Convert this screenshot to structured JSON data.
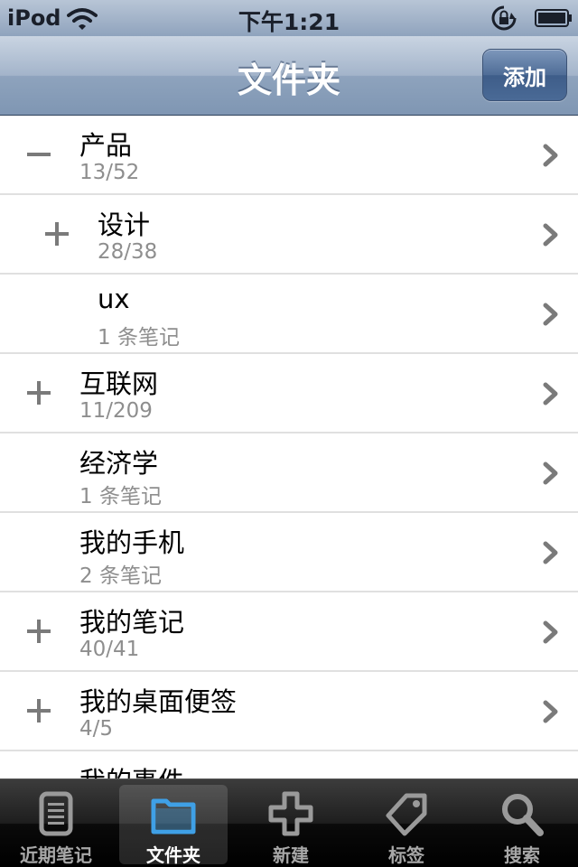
{
  "status_bar": {
    "carrier": "iPod",
    "time": "下午1:21"
  },
  "nav": {
    "title": "文件夹",
    "add_label": "添加"
  },
  "folders": [
    {
      "title": "产品",
      "subtitle": "13/52",
      "toggle": "minus",
      "indent": 0
    },
    {
      "title": "设计",
      "subtitle": "28/38",
      "toggle": "plus",
      "indent": 1
    },
    {
      "title": "ux",
      "subtitle": "1 条笔记",
      "toggle": "none",
      "indent": 1
    },
    {
      "title": "互联网",
      "subtitle": "11/209",
      "toggle": "plus",
      "indent": 0
    },
    {
      "title": "经济学",
      "subtitle": "1 条笔记",
      "toggle": "none",
      "indent": 0
    },
    {
      "title": "我的手机",
      "subtitle": "2 条笔记",
      "toggle": "none",
      "indent": 0
    },
    {
      "title": "我的笔记",
      "subtitle": "40/41",
      "toggle": "plus",
      "indent": 0
    },
    {
      "title": "我的桌面便签",
      "subtitle": "4/5",
      "toggle": "plus",
      "indent": 0
    },
    {
      "title": "我的事件",
      "subtitle": "",
      "toggle": "none",
      "indent": 0
    }
  ],
  "tabs": [
    {
      "label": "近期笔记",
      "icon": "recent-notes-icon",
      "active": false
    },
    {
      "label": "文件夹",
      "icon": "folder-icon",
      "active": true
    },
    {
      "label": "新建",
      "icon": "new-plus-icon",
      "active": false
    },
    {
      "label": "标签",
      "icon": "tag-icon",
      "active": false
    },
    {
      "label": "搜索",
      "icon": "search-icon",
      "active": false
    }
  ],
  "colors": {
    "nav_bar": "#8ea3bd",
    "active_tab_icon": "#3fa0e6",
    "subtitle_gray": "#8e8e8e"
  }
}
